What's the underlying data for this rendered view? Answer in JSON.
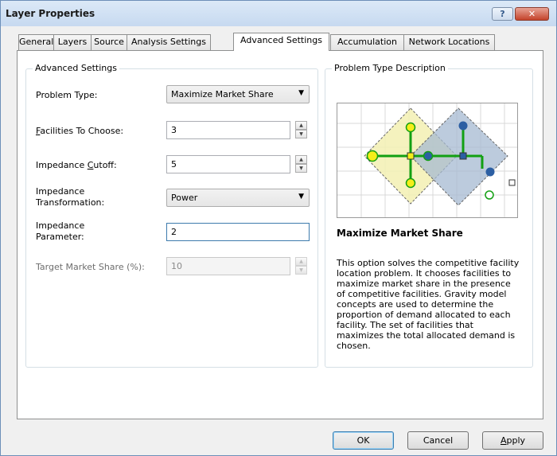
{
  "window": {
    "title": "Layer Properties",
    "help_glyph": "?",
    "close_glyph": "✕"
  },
  "tabs": [
    {
      "label": "General"
    },
    {
      "label": "Layers"
    },
    {
      "label": "Source"
    },
    {
      "label": "Analysis Settings"
    },
    {
      "label": "Advanced Settings",
      "active": true
    },
    {
      "label": "Accumulation"
    },
    {
      "label": "Network Locations"
    }
  ],
  "advanced": {
    "group_title": "Advanced Settings",
    "problem_type_label": "Problem Type:",
    "problem_type_value": "Maximize Market Share",
    "facilities_label_mnemonic": "F",
    "facilities_label_rest": "acilities To Choose:",
    "facilities_value": "3",
    "cutoff_label_pre": "Impedance ",
    "cutoff_label_mnemonic": "C",
    "cutoff_label_post": "utoff:",
    "cutoff_value": "5",
    "transform_label_line1": "Impedance",
    "transform_label_line2": "Transformation:",
    "transform_value": "Power",
    "param_label_line1": "Impedance",
    "param_label_line2": "Parameter:",
    "param_value": "2",
    "target_share_label": "Target Market Share (%):",
    "target_share_value": "10"
  },
  "description": {
    "group_title": "Problem Type Description",
    "problem_name": "Maximize Market Share",
    "text": "This option solves the competitive facility location problem. It chooses facilities to maximize market share in the presence of competitive facilities. Gravity model concepts are used to determine the proportion of demand allocated to each facility. The set of facilities that maximizes the total allocated demand is chosen."
  },
  "buttons": {
    "ok": "OK",
    "cancel": "Cancel",
    "apply_mnemonic": "A",
    "apply_rest": "pply"
  },
  "colors": {
    "title_bg": "#c6d9f0",
    "yellow_area": "#f3f0b3",
    "blue_area": "#a6b9d1",
    "network_green": "#12a012",
    "facility_yellow": "#f4ee1a",
    "facility_blue": "#2c5fa3"
  }
}
